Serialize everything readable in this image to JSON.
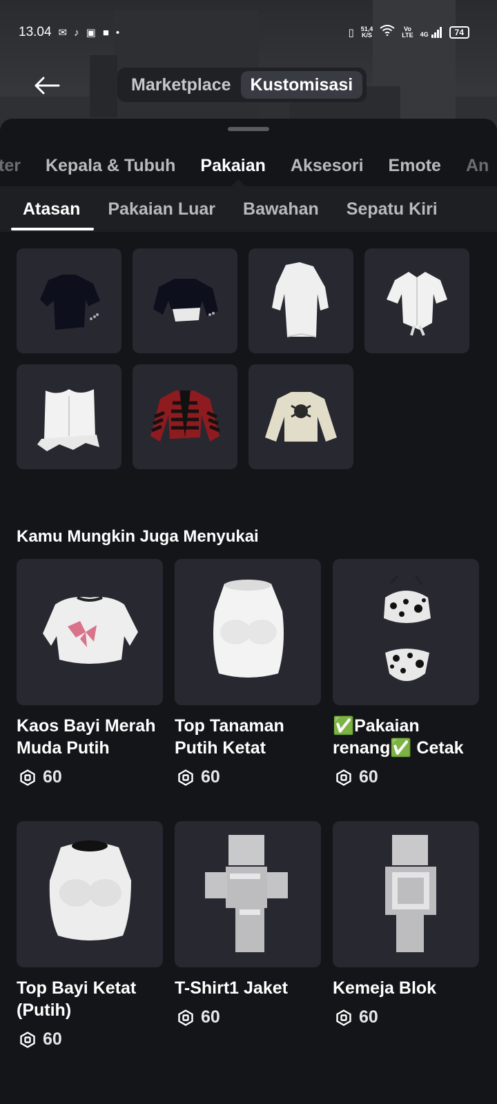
{
  "status_bar": {
    "time": "13.04",
    "net_speed_value": "51,4",
    "net_speed_unit": "K/S",
    "volte_top": "Vo",
    "volte_bottom": "LTE",
    "network": "4G",
    "battery": "74"
  },
  "header": {
    "tabs": [
      {
        "label": "Marketplace",
        "active": false
      },
      {
        "label": "Kustomisasi",
        "active": true
      }
    ]
  },
  "categories": {
    "items": [
      {
        "label": "ter"
      },
      {
        "label": "Kepala & Tubuh"
      },
      {
        "label": "Pakaian",
        "active": true
      },
      {
        "label": "Aksesori"
      },
      {
        "label": "Emote"
      },
      {
        "label": "An"
      }
    ]
  },
  "subcategories": {
    "items": [
      {
        "label": "Atasan",
        "active": true
      },
      {
        "label": "Pakaian Luar"
      },
      {
        "label": "Bawahan"
      },
      {
        "label": "Sepatu Kiri"
      }
    ]
  },
  "inventory": {
    "items": [
      {
        "icon": "black-tshirt-icon"
      },
      {
        "icon": "black-crop-top-icon"
      },
      {
        "icon": "white-long-shirt-icon"
      },
      {
        "icon": "white-tied-shirt-icon"
      },
      {
        "icon": "white-corset-top-icon"
      },
      {
        "icon": "red-striped-cardigan-icon"
      },
      {
        "icon": "beige-sweater-icon"
      }
    ]
  },
  "recommendations": {
    "title": "Kamu Mungkin Juga Menyukai",
    "currency_icon": "robux-icon",
    "items": [
      {
        "name": "Kaos Bayi Merah Muda Putih",
        "price": "60"
      },
      {
        "name": "Top Tanaman Putih Ketat",
        "price": "60"
      },
      {
        "name": "✅Pakaian renang✅ Cetak",
        "price": "60"
      },
      {
        "name": "Top Bayi Ketat (Putih)",
        "price": "60"
      },
      {
        "name": "T-Shirt1 Jaket",
        "price": "60"
      },
      {
        "name": "Kemeja Blok",
        "price": "60"
      }
    ]
  },
  "colors": {
    "background": "#141518",
    "tile": "#272830",
    "active_tab": "#393b43"
  }
}
